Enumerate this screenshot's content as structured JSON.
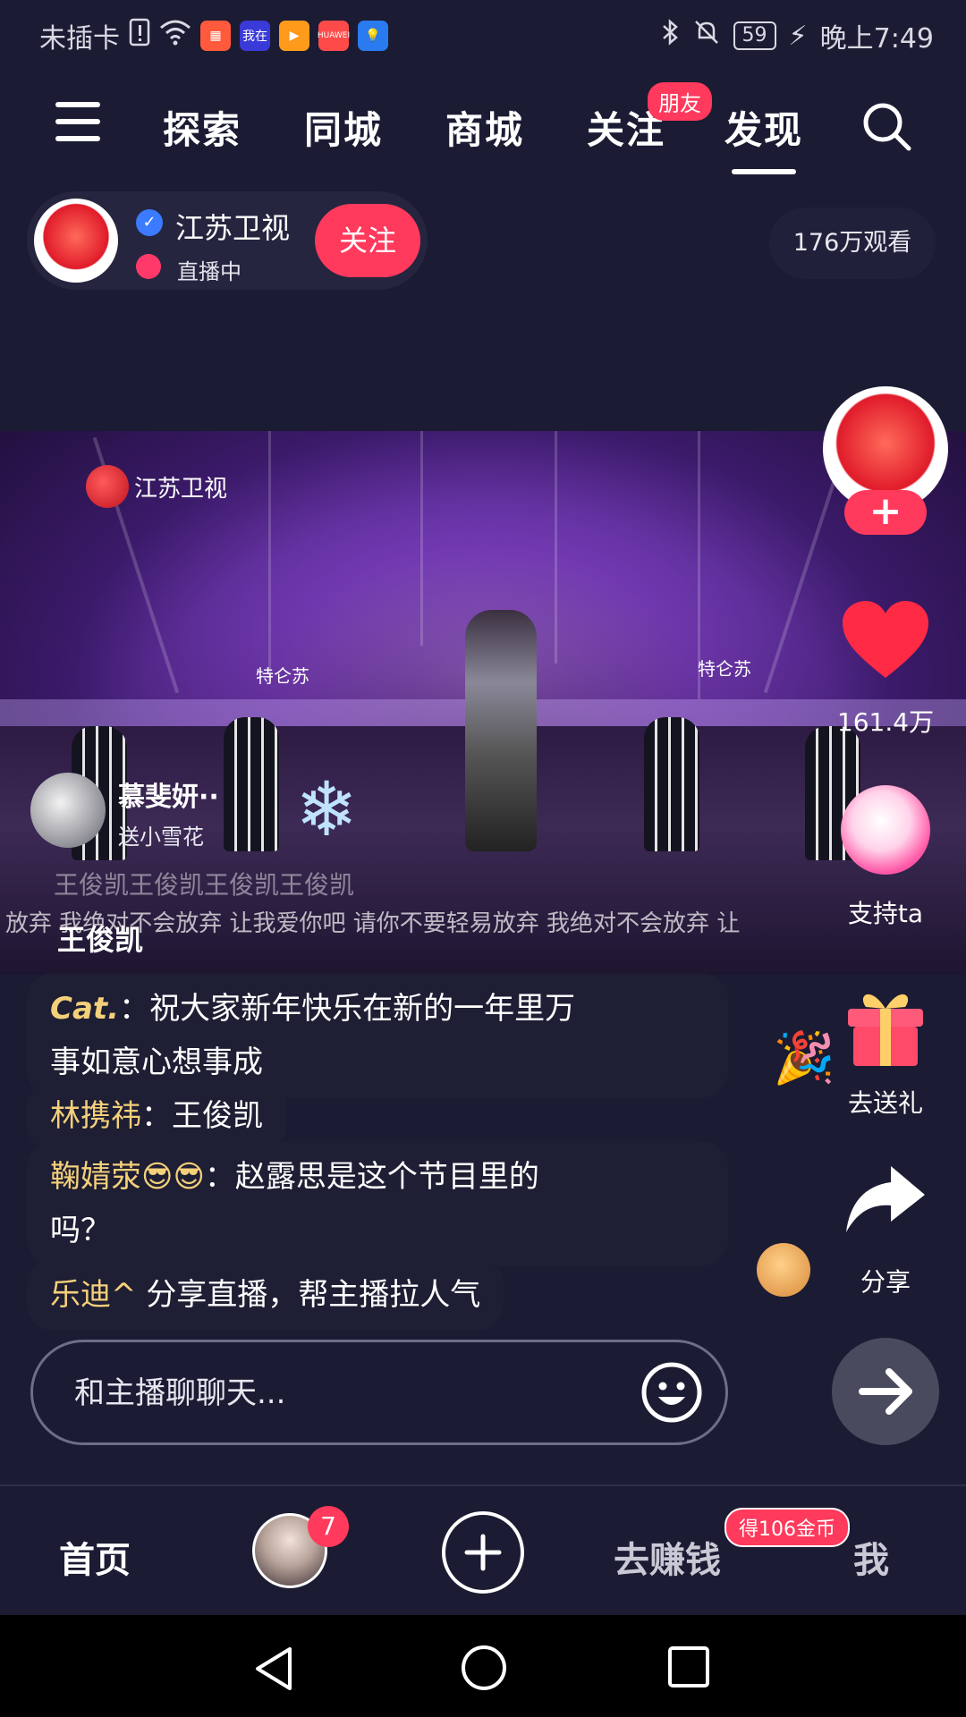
{
  "status_bar": {
    "carrier": "未插卡",
    "app_icons": [
      {
        "name": "sim-alert-icon",
        "label": ""
      },
      {
        "name": "wifi-icon",
        "label": ""
      },
      {
        "name": "app-icon-1",
        "label": "",
        "color": "#ff5a3c"
      },
      {
        "name": "app-icon-2",
        "label": "我在",
        "color": "#3a3ad8"
      },
      {
        "name": "app-icon-3",
        "label": "",
        "color": "#ff9a1a"
      },
      {
        "name": "app-icon-4",
        "label": "HUAWEI",
        "color": "#ff4a4a"
      },
      {
        "name": "app-icon-5",
        "label": "",
        "color": "#2a7af0"
      }
    ],
    "battery": "59",
    "time": "晚上7:49"
  },
  "top_nav": {
    "tabs": [
      {
        "label": "探索"
      },
      {
        "label": "同城"
      },
      {
        "label": "商城"
      },
      {
        "label": "关注"
      },
      {
        "label": "发现",
        "active": true
      }
    ],
    "friend_badge": "朋友"
  },
  "streamer": {
    "name": "江苏卫视",
    "status": "直播中",
    "follow_label": "关注",
    "viewers": "176万观看"
  },
  "video": {
    "station_logo": "江苏卫视",
    "stage_tag_left": "特仑苏",
    "stage_tag_right": "特仑苏",
    "lyrics_line1": "王俊凯王俊凯王俊凯王俊凯",
    "lyrics_line2": "放弃 我绝对不会放弃 让我爱你吧 请你不要轻易放弃 我绝对不会放弃 让",
    "caption": "王俊凯",
    "gift_user": "慕斐妍··",
    "gift_text": "送小雪花"
  },
  "right_rail": {
    "likes": "161.4万",
    "support_label": "支持ta",
    "gift_label": "去送礼",
    "share_label": "分享"
  },
  "chat": [
    {
      "name": "Cat.",
      "text": "祝大家新年快乐在新的一年里万",
      "text2": "事如意心想事成"
    },
    {
      "name": "林携祎",
      "text": "王俊凯"
    },
    {
      "name": "鞠婧荥😎😎",
      "text": "赵露思是这个节目里的",
      "text2": "吗？"
    },
    {
      "name": "乐迪^",
      "text": "分享直播，帮主播拉人气"
    }
  ],
  "chat_input": {
    "placeholder": "和主播聊聊天..."
  },
  "bottom_nav": {
    "home": "首页",
    "avatar_badge": "7",
    "earn": "去赚钱",
    "earn_badge": "得106金币",
    "me": "我"
  },
  "colors": {
    "accent": "#ff3a5c",
    "background": "#1b1b33",
    "chat_name": "#f4d07a"
  }
}
